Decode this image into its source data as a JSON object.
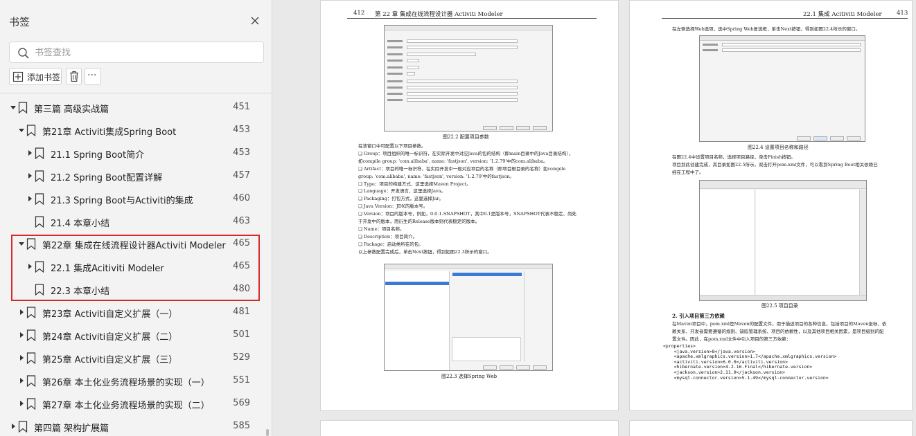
{
  "sidebar": {
    "title": "书签",
    "search_placeholder": "书签查找",
    "add_bookmark_label": "添加书签",
    "more_label": "···",
    "items": [
      {
        "label": "第三篇  高级实战篇",
        "page": "451",
        "level": 0,
        "expanded": true
      },
      {
        "label": "第21章  Activiti集成Spring Boot",
        "page": "453",
        "level": 1,
        "expanded": true
      },
      {
        "label": "21.1 Spring Boot简介",
        "page": "453",
        "level": 2,
        "expanded": false
      },
      {
        "label": "21.2 Spring Boot配置详解",
        "page": "457",
        "level": 2,
        "expanded": false
      },
      {
        "label": "21.3  Spring Boot与Activiti的集成",
        "page": "460",
        "level": 2,
        "expanded": false
      },
      {
        "label": "21.4  本章小结",
        "page": "463",
        "level": 2,
        "expanded": null
      },
      {
        "label": "第22章  集成在线流程设计器Activiti Modeler",
        "page": "465",
        "level": 1,
        "expanded": true
      },
      {
        "label": "22.1 集成Acitiviti Modeler",
        "page": "465",
        "level": 2,
        "expanded": false
      },
      {
        "label": "22.3  本章小结",
        "page": "480",
        "level": 2,
        "expanded": null
      },
      {
        "label": "第23章  Activiti自定义扩展（一）",
        "page": "481",
        "level": 1,
        "expanded": false
      },
      {
        "label": "第24章  Activiti自定义扩展（二）",
        "page": "501",
        "level": 1,
        "expanded": false
      },
      {
        "label": "第25章  Activiti自定义扩展（三）",
        "page": "529",
        "level": 1,
        "expanded": false
      },
      {
        "label": "第26章  本土化业务流程场景的实现（一）",
        "page": "551",
        "level": 1,
        "expanded": false
      },
      {
        "label": "第27章  本土化业务流程场景的实现（二）",
        "page": "569",
        "level": 1,
        "expanded": false
      },
      {
        "label": "第四篇  架构扩展篇",
        "page": "585",
        "level": 0,
        "expanded": false
      }
    ],
    "highlight_color": "#d62a2a"
  },
  "doc": {
    "left_page": {
      "page_no": "412",
      "header": "第 22 章   集成在线流程设计器 Activiti Modeler",
      "fig1_caption": "图22.2   配置项目参数",
      "fig2_caption": "图22.3   选择Spring Web",
      "paragraphs": [
        "在该窗口中可配置以下项目参数。",
        "❑ Group：项目组织的唯一标识符，在实际开发中对应Java的包的结构（即main目录中的Java目录结构），",
        "    如compile group: 'com.alibaba', name: 'fastjson', version: '1.2.79'中的com.alibaba。",
        "❑ Artifact：项目的唯一标识符，在实际开发中一般对应项目的名称（即项目根目录的名称）如compile",
        "    group: 'com.alibaba', name: 'fastjson', version: '1.2.79'中的fastjson。",
        "❑ Type：项目的构建方式，这里选择Maven Project。",
        "❑ Language：开发语言，这里选择Java。",
        "❑ Packaging：打包方式，这里选择Jar。",
        "❑ Java Version：JDK的版本号。",
        "❑ Version：项目的版本号，例如，0.0.1-SNAPSHOT，其中0.1是版本号，SNAPSHOT代表不稳定、尚处",
        "    于开发中的版本，而衍生的Release版本则代表稳定的版本。",
        "❑ Name：项目名称。",
        "❑ Description：项目简介。",
        "❑ Package：启动类所在的包。",
        "以上参数配置完成后，单击Next按钮，得到如图22.3所示的窗口。"
      ]
    },
    "right_page": {
      "page_no": "413",
      "header": "22.1   集成 Acitiviti Modeler",
      "intro": "在左侧选择Web选项，选中Spring Web复选框，单击Next按钮，得到如图22.4所示的窗口。",
      "fig1_caption": "图22.4   设置项目名称和路径",
      "fig2_caption": "图22.5   项目目录",
      "para1": [
        "在图22.4中设置项目名称，选择项目路径，单击Finish按钮。",
        "项目到此创建完成，其目录如图22.5所示，双击打开pom.xml文件，可以看到Spring Boot相关依赖已",
        "经在工程中了。"
      ],
      "section": "2.  引入项目第三方依赖",
      "para2": [
        "在Maven项目中，pom.xml是Maven的配置文件，用于描述项目的各种信息，包括项目的Maven坐标、依",
        "赖关系、开发者需要遵循的规则、缺陷管理系统、项目的依赖性，以及其他项目相关因素，是项目级别的配",
        "置文件。因此，在pom.xml文件中引入项目的第三方依赖："
      ],
      "code": [
        "<properties>",
        "    <java.version>8</java.version>",
        "    <apache.xmlgraphics.version>1.7</apache.xmlgraphics.version>",
        "    <activiti.version>6.0.0</activiti.version>",
        "    <hibernate.version>4.2.16.Final</hibernate.version>",
        "    <jackson.version>2.11.0</jackson.version>",
        "    <mysql-connector.version>5.1.49</mysql-connector.version>"
      ]
    }
  }
}
